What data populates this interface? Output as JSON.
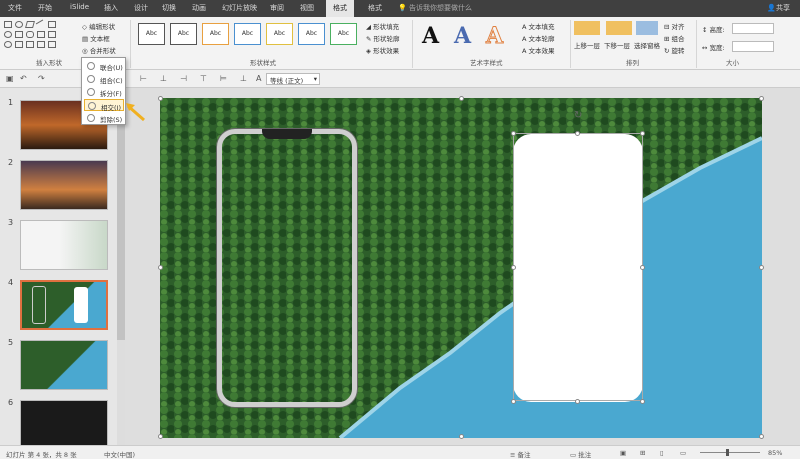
{
  "tabs": [
    "文件",
    "开始",
    "iSlide",
    "插入",
    "设计",
    "切换",
    "动画",
    "幻灯片放映",
    "审阅",
    "视图",
    "格式"
  ],
  "active_tab": "格式",
  "tell_me": "告诉我你想要做什么",
  "share": "共享",
  "ribbon": {
    "insert_shapes": {
      "edit_shape": "编辑形状",
      "textbox": "文本框",
      "merge_shapes": "合并形状",
      "group_label": "插入形状"
    },
    "shape_styles": {
      "abc": "Abc",
      "fill": "形状填充",
      "outline": "形状轮廓",
      "effects": "形状效果",
      "group_label": "形状样式"
    },
    "wordart": {
      "letter": "A",
      "text_fill": "文本填充",
      "text_outline": "文本轮廓",
      "text_effects": "文本效果",
      "group_label": "艺术字样式"
    },
    "arrange": {
      "bring_forward": "上移一层",
      "send_backward": "下移一层",
      "selection_pane": "选择窗格",
      "align": "对齐",
      "group": "组合",
      "rotate": "旋转",
      "group_label": "排列"
    },
    "size": {
      "height_label": "高度:",
      "width_label": "宽度:",
      "group_label": "大小"
    }
  },
  "font_selector": "等线 (正文)",
  "merge_menu": [
    "联合(U)",
    "组合(C)",
    "拆分(F)",
    "相交(I)",
    "剪除(S)"
  ],
  "merge_menu_highlight": 3,
  "slides": [
    "1",
    "2",
    "3",
    "4",
    "5",
    "6"
  ],
  "selected_slide": 4,
  "status": {
    "slide_info": "幻灯片 第 4 张，共 8 张",
    "language": "中文(中国)",
    "notes": "备注",
    "comments": "批注",
    "zoom": "85%"
  },
  "colors": {
    "accent": "#e07040",
    "lake": "#4aa8d0",
    "forest": "#2d5e2a",
    "tab_bar": "#404040",
    "highlight": "#e8b030"
  }
}
